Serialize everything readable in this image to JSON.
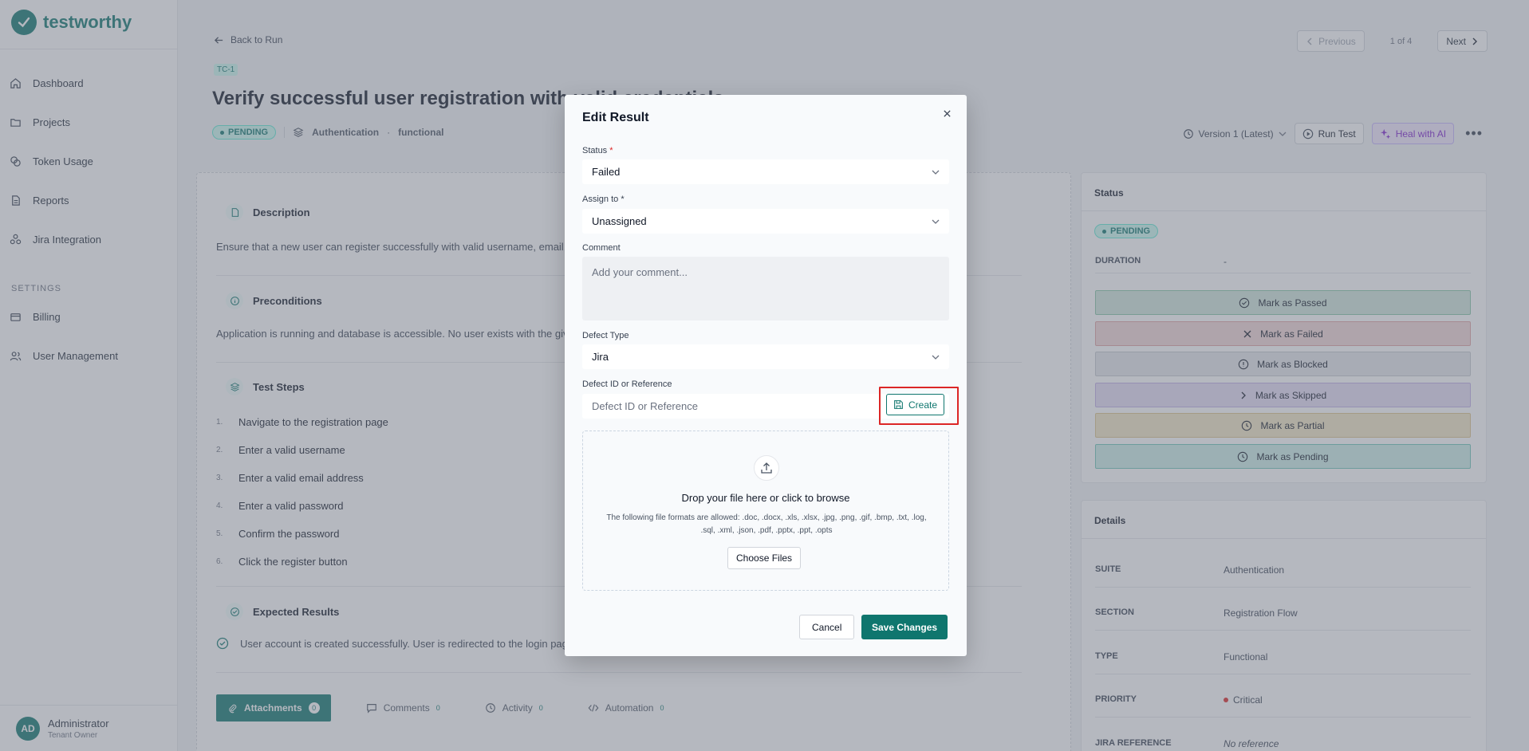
{
  "app": {
    "name": "testworthy"
  },
  "sidebar": {
    "items": [
      {
        "label": "Dashboard",
        "icon": "home-icon"
      },
      {
        "label": "Projects",
        "icon": "folder-icon"
      },
      {
        "label": "Token Usage",
        "icon": "coins-icon"
      },
      {
        "label": "Reports",
        "icon": "file-icon"
      },
      {
        "label": "Jira Integration",
        "icon": "integration-icon"
      }
    ],
    "settings_label": "SETTINGS",
    "settings_items": [
      {
        "label": "Billing",
        "icon": "card-icon"
      },
      {
        "label": "User Management",
        "icon": "users-icon"
      }
    ],
    "user": {
      "initials": "AD",
      "name": "Administrator",
      "role": "Tenant Owner"
    }
  },
  "header": {
    "back_label": "Back to Run",
    "previous_label": "Previous",
    "page_count": "1 of 4",
    "next_label": "Next",
    "test_id": "TC-1",
    "title": "Verify successful user registration with valid credentials",
    "status": "PENDING",
    "suite": "Authentication",
    "type": "functional",
    "version_label": "Version 1 (Latest)",
    "run_test_label": "Run Test",
    "heal_label": "Heal with AI"
  },
  "sections": {
    "description": {
      "title": "Description",
      "text": "Ensure that a new user can register successfully with valid username, email, and password."
    },
    "preconditions": {
      "title": "Preconditions",
      "text": "Application is running and database is accessible. No user exists with the given email."
    },
    "test_steps": {
      "title": "Test Steps",
      "steps": [
        {
          "num": "1.",
          "text": "Navigate to the registration page"
        },
        {
          "num": "2.",
          "text": "Enter a valid username"
        },
        {
          "num": "3.",
          "text": "Enter a valid email address"
        },
        {
          "num": "4.",
          "text": "Enter a valid password"
        },
        {
          "num": "5.",
          "text": "Confirm the password"
        },
        {
          "num": "6.",
          "text": "Click the register button"
        }
      ]
    },
    "expected": {
      "title": "Expected Results",
      "text": "User account is created successfully. User is redirected to the login page."
    }
  },
  "tabs": [
    {
      "label": "Attachments",
      "count": "0"
    },
    {
      "label": "Comments",
      "count": "0"
    },
    {
      "label": "Activity",
      "count": "0"
    },
    {
      "label": "Automation",
      "count": "0"
    }
  ],
  "status_card": {
    "title": "Status",
    "status": "PENDING",
    "duration_label": "DURATION",
    "duration_value": "-",
    "buttons": [
      {
        "label": "Mark as Passed",
        "bg": "#d1e7dd",
        "border": "#86c7a6"
      },
      {
        "label": "Mark as Failed",
        "bg": "#f2d6d6",
        "border": "#e0a3a3"
      },
      {
        "label": "Mark as Blocked",
        "bg": "#e5e7eb",
        "border": "#c4c8ce"
      },
      {
        "label": "Mark as Skipped",
        "bg": "#e5dcf5",
        "border": "#c1aee6"
      },
      {
        "label": "Mark as Partial",
        "bg": "#f3e7c4",
        "border": "#dcc58a"
      },
      {
        "label": "Mark as Pending",
        "bg": "#cdeee9",
        "border": "#6fc7b9"
      }
    ]
  },
  "details_card": {
    "title": "Details",
    "rows": [
      {
        "key": "SUITE",
        "value": "Authentication"
      },
      {
        "key": "SECTION",
        "value": "Registration Flow"
      },
      {
        "key": "TYPE",
        "value": "Functional"
      },
      {
        "key": "PRIORITY",
        "value": "Critical"
      },
      {
        "key": "JIRA REFERENCE",
        "value": "No reference"
      }
    ]
  },
  "modal": {
    "title": "Edit Result",
    "status_label": "Status",
    "status_value": "Failed",
    "assign_label": "Assign to",
    "assign_value": "Unassigned",
    "comment_label": "Comment",
    "comment_placeholder": "Add your comment...",
    "defect_type_label": "Defect Type",
    "defect_type_value": "Jira",
    "defect_id_label": "Defect ID or Reference",
    "defect_id_placeholder": "Defect ID or Reference",
    "create_label": "Create",
    "drop_title": "Drop your file here or click to browse",
    "drop_help": "The following file formats are allowed: .doc, .docx, .xls, .xlsx, .jpg, .png, .gif, .bmp, .txt, .log, .sql, .xml, .json, .pdf, .pptx, .ppt, .opts",
    "choose_files_label": "Choose Files",
    "cancel_label": "Cancel",
    "save_label": "Save Changes"
  },
  "colors": {
    "brand": "#0f766e",
    "highlight": "#dc2626",
    "critical": "#dc2626"
  }
}
